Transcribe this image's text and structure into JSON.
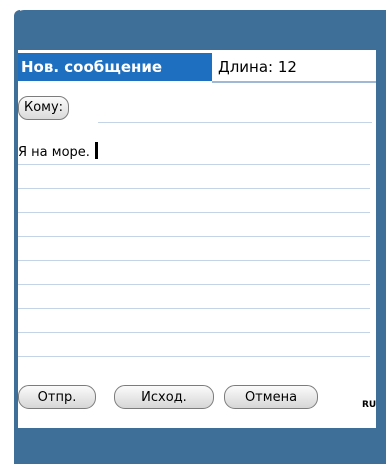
{
  "title": {
    "tab_label": "Нов. сообщение",
    "length_label": "Длина: 12"
  },
  "recipient": {
    "button_label": "Кому:"
  },
  "message": {
    "text": "Я на море."
  },
  "buttons": {
    "send": "Отпр.",
    "outbox": "Исход.",
    "cancel": "Отмена"
  },
  "input_mode": "RU",
  "colors": {
    "frame": "#3d6f99",
    "title_tab": "#1e6fc0",
    "rule_lines": "#c2d4e6"
  }
}
